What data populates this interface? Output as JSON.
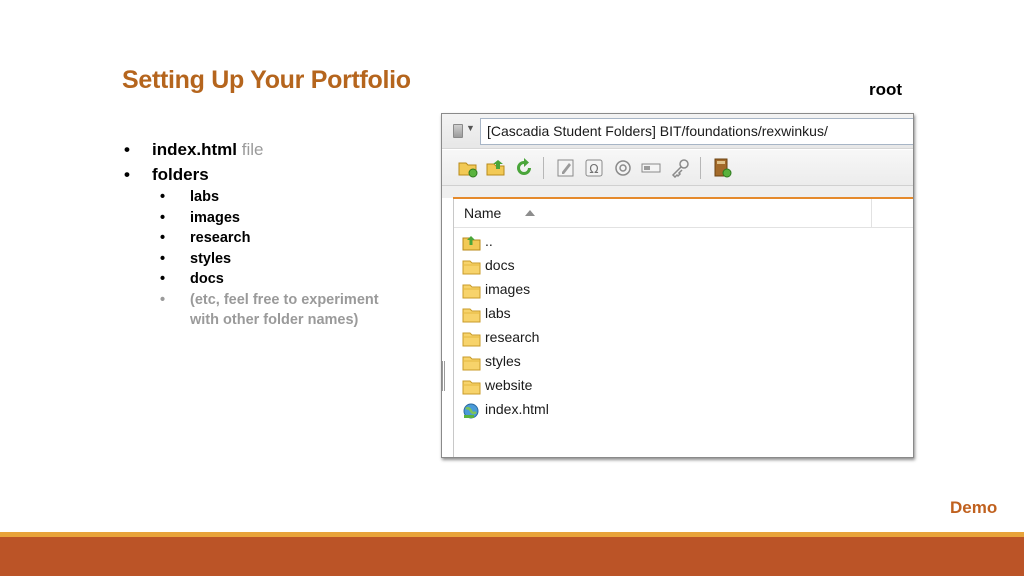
{
  "slide": {
    "title": "Setting Up Your Portfolio",
    "root_label": "root",
    "demo_label": "Demo",
    "colors": {
      "title": "#b5651d",
      "accent": "#e58a2c",
      "footer": "#bb5427",
      "footer_stripe": "#e8a33a"
    }
  },
  "bullets": {
    "top": [
      {
        "bold": "index.html",
        "muted": "file"
      },
      {
        "bold": "folders",
        "muted": ""
      }
    ],
    "sub": [
      "labs",
      "images",
      "research",
      "styles",
      "docs"
    ],
    "note_line1": "(etc, feel free to experiment",
    "note_line2": "with other folder names)",
    "bullet_char": "•"
  },
  "explorer": {
    "address": "[Cascadia Student Folders] BIT/foundations/rexwinkus/",
    "column_header": "Name",
    "toolbar_icons": [
      "new-folder-icon",
      "upload-folder-icon",
      "refresh-icon",
      "edit-icon",
      "omega-icon",
      "target-icon",
      "rename-icon",
      "key-icon",
      "bookmark-icon"
    ],
    "items": [
      {
        "name": "..",
        "icon": "parent-folder-icon"
      },
      {
        "name": "docs",
        "icon": "folder-icon"
      },
      {
        "name": "images",
        "icon": "folder-icon"
      },
      {
        "name": "labs",
        "icon": "folder-icon"
      },
      {
        "name": "research",
        "icon": "folder-icon"
      },
      {
        "name": "styles",
        "icon": "folder-icon"
      },
      {
        "name": "website",
        "icon": "folder-icon"
      },
      {
        "name": "index.html",
        "icon": "html-file-icon"
      }
    ]
  }
}
